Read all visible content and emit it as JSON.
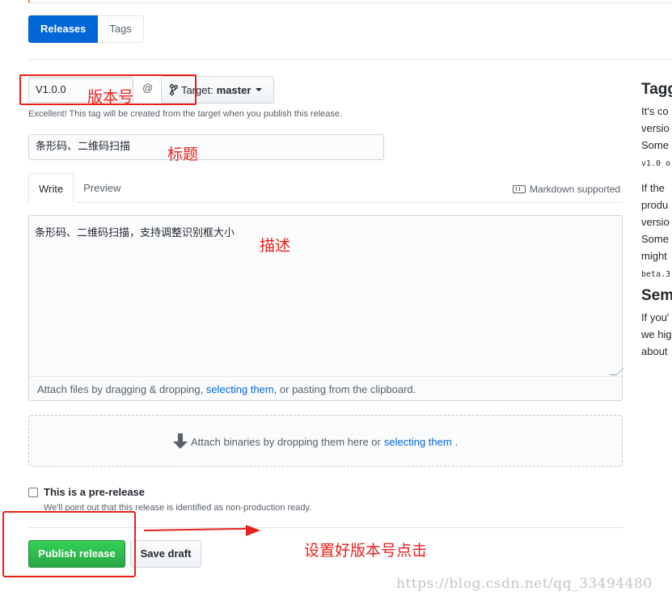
{
  "release_nav": {
    "releases_tab": "Releases",
    "tags_tab": "Tags"
  },
  "tag_form": {
    "tag_value": "V1.0.0",
    "at_sign": "@",
    "target_prefix": "Target:",
    "target_branch": "master",
    "note": "Excellent! This tag will be created from the target when you publish this release."
  },
  "title_field": {
    "value": "条形码、二维码扫描"
  },
  "editor": {
    "write_tab": "Write",
    "preview_tab": "Preview",
    "markdown_note": "Markdown supported",
    "body": "条形码、二维码扫描，支持调整识别框大小",
    "attach_prefix": "Attach files by dragging & dropping, ",
    "attach_link": "selecting them",
    "attach_suffix": ", or pasting from the clipboard."
  },
  "binaries": {
    "prefix": "Attach binaries by dropping them here or ",
    "link": "selecting them",
    "suffix": "."
  },
  "prerelease": {
    "label": "This is a pre-release",
    "hint": "We'll point out that this release is identified as non-production ready."
  },
  "actions": {
    "publish": "Publish release",
    "save_draft": "Save draft"
  },
  "annotations": {
    "version": "版本号",
    "title": "标题",
    "description": "描述",
    "click": "设置好版本号点击"
  },
  "sidebar": {
    "heading1": "Tagg",
    "lines1": [
      "It's co",
      "versio",
      "Some",
      "v1.0 o"
    ],
    "lines2": [
      "If the",
      "produ",
      "versio",
      "Some",
      "might",
      "beta.3"
    ],
    "heading2": "Sem",
    "lines3": [
      "If you'",
      "we hig",
      "about"
    ]
  },
  "watermark": "https://blog.csdn.net/qq_33494480",
  "colors": {
    "primary": "#0366d6",
    "publish": "#28a745",
    "annotation": "#e8201a"
  }
}
